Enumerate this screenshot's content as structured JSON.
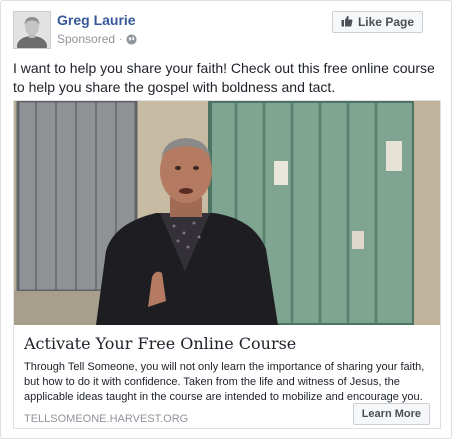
{
  "page": {
    "name": "Greg Laurie",
    "sponsored_label": "Sponsored",
    "like_button_label": "Like Page"
  },
  "post": {
    "text": "I want to help you share your faith! Check out this free online course to help you share the gospel with boldness and tact."
  },
  "attachment": {
    "title": "Activate Your Free Online Course",
    "description": "Through Tell Someone, you will not only learn the importance of sharing your faith, but how to do it with confidence. Taken from the life and witness of Jesus, the applicable ideas taught in the course are intended to mobilize and encourage you.",
    "domain": "TELLSOMEONE.HARVEST.ORG",
    "cta_label": "Learn More"
  },
  "colors": {
    "page_name": "#365899",
    "meta_gray": "#90949c",
    "button_bg": "#f6f7f9",
    "border": "#dddfe2"
  },
  "icons": {
    "like": "thumbs-up-icon",
    "audience": "globe-icon"
  }
}
